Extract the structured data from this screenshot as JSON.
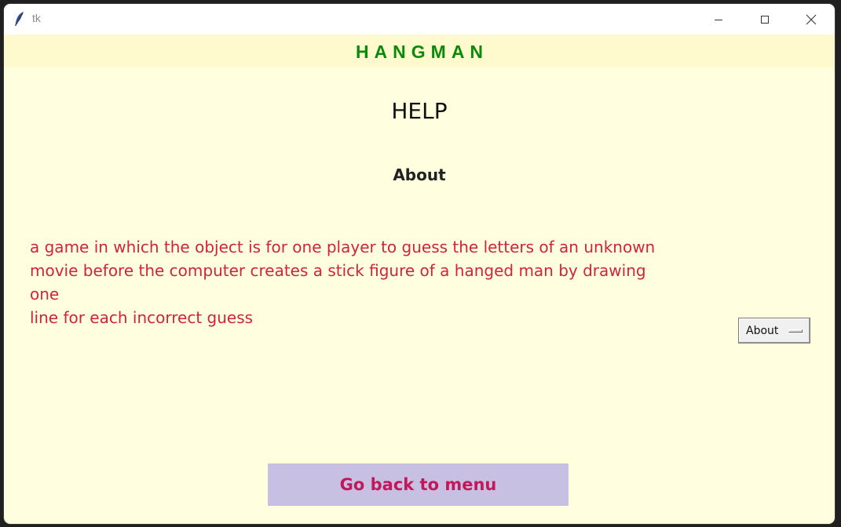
{
  "window": {
    "title": "tk",
    "controls": [
      "minimize",
      "maximize",
      "close"
    ]
  },
  "banner": {
    "text": "HANGMAN"
  },
  "page": {
    "title": "HELP",
    "section_title": "About",
    "description_lines": [
      "a game in which the object is for one player to guess the letters of an unknown",
      "movie before the computer creates a stick figure of a hanged man by drawing",
      "one",
      "line for each incorrect guess"
    ]
  },
  "topic_menu": {
    "selected": "About"
  },
  "back_button": {
    "label": "Go back to menu"
  },
  "colors": {
    "background": "#ffffe0",
    "banner_bg": "#fffacd",
    "banner_text": "#0a8a0a",
    "description_text": "#d2233c",
    "button_bg": "#c8c0e2",
    "button_text": "#c2185b"
  },
  "icons": {
    "app": "feather-icon",
    "minimize": "minimize-icon",
    "maximize": "maximize-icon",
    "close": "close-icon"
  }
}
